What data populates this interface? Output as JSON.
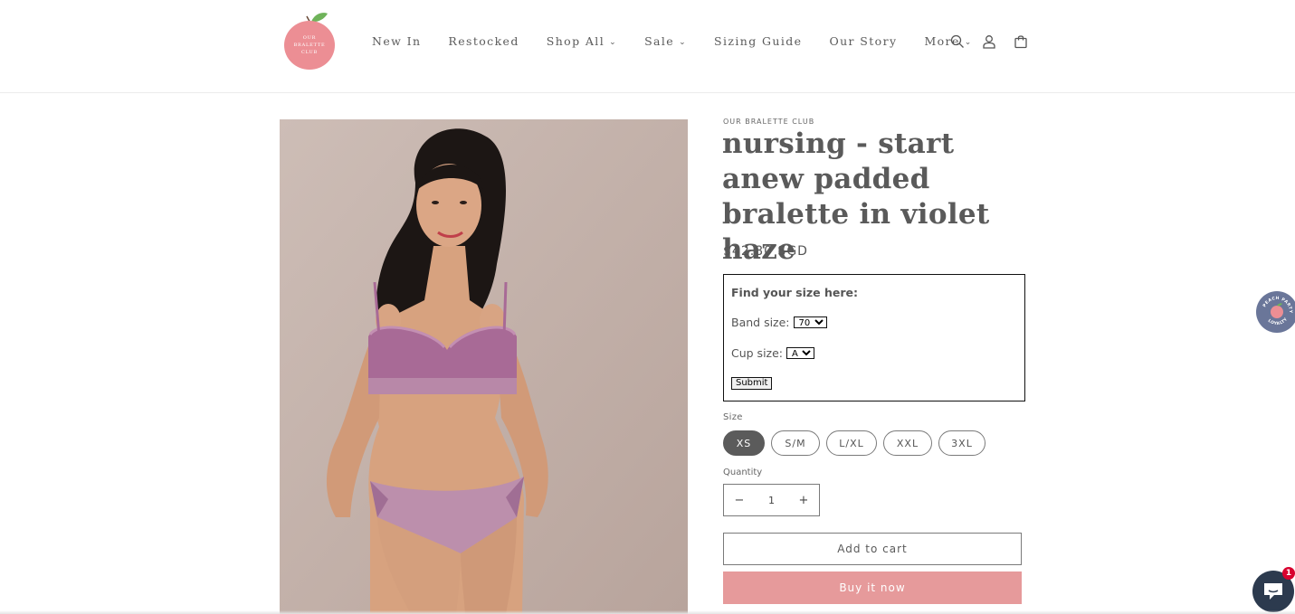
{
  "header": {
    "logo_text": [
      "OUR",
      "BRALETTE",
      "CLUB"
    ],
    "nav": [
      {
        "label": "New In",
        "dropdown": false
      },
      {
        "label": "Restocked",
        "dropdown": false
      },
      {
        "label": "Shop All",
        "dropdown": true
      },
      {
        "label": "Sale",
        "dropdown": true
      },
      {
        "label": "Sizing Guide",
        "dropdown": false
      },
      {
        "label": "Our Story",
        "dropdown": false
      },
      {
        "label": "More",
        "dropdown": true
      }
    ],
    "icons": [
      "search-icon",
      "account-icon",
      "cart-icon"
    ]
  },
  "product": {
    "vendor": "OUR BRALETTE CLUB",
    "title": "nursing - start anew padded bralette in violet haze",
    "price": "$42.80 SGD"
  },
  "size_finder": {
    "heading": "Find your size here:",
    "band_label": "Band size:",
    "band_value": "70",
    "cup_label": "Cup size:",
    "cup_value": "A",
    "submit_label": "Submit"
  },
  "size": {
    "label": "Size",
    "options": [
      "XS",
      "S/M",
      "L/XL",
      "XXL",
      "3XL"
    ],
    "selected": "XS"
  },
  "quantity": {
    "label": "Quantity",
    "value": "1",
    "minus": "−",
    "plus": "+"
  },
  "buttons": {
    "add_to_cart": "Add to cart",
    "buy_now": "Buy it now"
  },
  "widgets": {
    "loyalty_text": "PEACH PARTY LOYALTY",
    "chat_badge": "1"
  },
  "colors": {
    "brand_pink": "#e69a9b",
    "selected_pill": "#5b5b5b",
    "loyalty_bg": "#6a7699",
    "chat_bg": "#2c3a4e",
    "badge": "#d8002e"
  }
}
